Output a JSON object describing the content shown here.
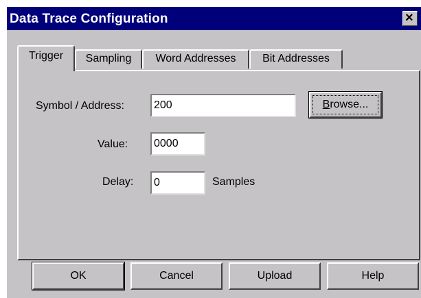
{
  "window": {
    "title": "Data Trace Configuration",
    "close_glyph": "×"
  },
  "tabs": [
    {
      "label": "Trigger",
      "active": true
    },
    {
      "label": "Sampling",
      "active": false
    },
    {
      "label": "Word Addresses",
      "active": false
    },
    {
      "label": "Bit Addresses",
      "active": false
    }
  ],
  "trigger": {
    "symbol_label": "Symbol / Address:",
    "symbol_value": "200",
    "browse_label_underlined": "B",
    "browse_label_rest": "rowse...",
    "value_label": "Value:",
    "value_value": "0000",
    "delay_label": "Delay:",
    "delay_value": "0",
    "delay_unit": "Samples"
  },
  "buttons": {
    "ok": "OK",
    "cancel": "Cancel",
    "upload": "Upload",
    "help": "Help"
  },
  "icons": {
    "close": "close-icon"
  }
}
